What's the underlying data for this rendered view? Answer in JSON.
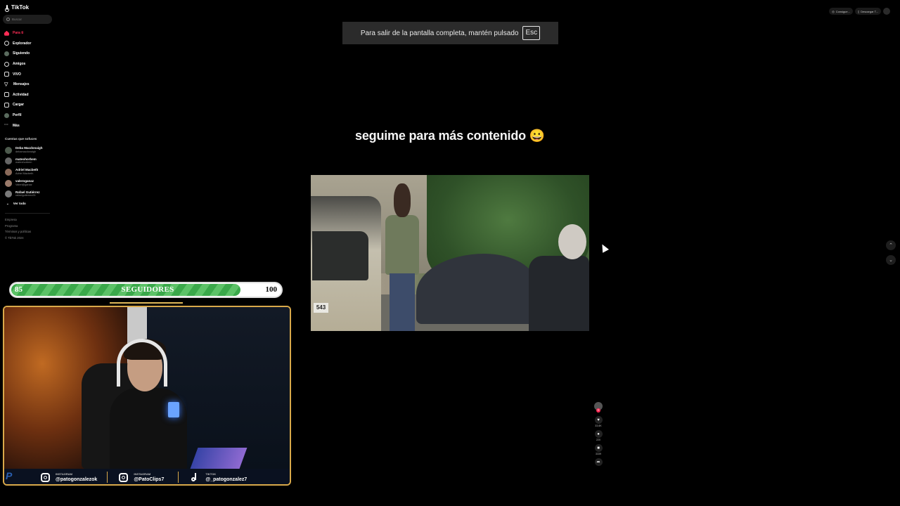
{
  "sidebar": {
    "logo": "TikTok",
    "search_placeholder": "Buscar",
    "nav": [
      {
        "label": "Para ti",
        "icon": "home-icon",
        "active": true
      },
      {
        "label": "Explorador",
        "icon": "compass-icon"
      },
      {
        "label": "Siguiendo",
        "icon": "following-icon"
      },
      {
        "label": "Amigos",
        "icon": "friends-icon"
      },
      {
        "label": "VIVO",
        "icon": "live-icon"
      },
      {
        "label": "Mensajes",
        "icon": "message-icon"
      },
      {
        "label": "Actividad",
        "icon": "activity-icon"
      },
      {
        "label": "Cargar",
        "icon": "upload-icon"
      },
      {
        "label": "Perfil",
        "icon": "profile-avatar"
      },
      {
        "label": "Más",
        "icon": "more-icon"
      }
    ],
    "following_title": "Cuentas que sofuces",
    "following": [
      {
        "name": "Deba Macdonaigh",
        "user": "debamacdonaigh"
      },
      {
        "name": "mateohorbem",
        "user": "mateohorbem"
      },
      {
        "name": "Adriel Macbeth",
        "user": "Adriel Macbeth"
      },
      {
        "name": "valeroganaz",
        "user": "Valeri@ganaz"
      },
      {
        "name": "Rafael Gutiérrez",
        "user": "rafaelgutierrez26"
      }
    ],
    "see_all": "Ver todo",
    "footer": [
      "Empresa",
      "Programa",
      "Términos y políticas",
      "© TikTok 2024"
    ]
  },
  "top_right": {
    "btn1": "Consigue...",
    "btn2": "Descargar T..."
  },
  "fullscreen_banner": {
    "text": "Para salir de la pantalla completa, mantén pulsado",
    "key": "Esc"
  },
  "video": {
    "caption": "seguime para más contenido 😀",
    "plate": "543"
  },
  "actions": {
    "likes": "33,6K",
    "comments": "220",
    "saves": "3339"
  },
  "overlay": {
    "goal_start": "85",
    "goal_label": "SEGUIDORES",
    "goal_end": "100",
    "goal_progress": 0.85,
    "social": [
      {
        "platform": "INSTAGRAM",
        "handle": "@patogonzalezok"
      },
      {
        "platform": "INSTAGRAM",
        "handle": "@PatoClips7"
      },
      {
        "platform": "TIKTOK",
        "handle": "@_patogonzalez7"
      }
    ]
  },
  "colors": {
    "accent": "#fe2c55",
    "goal_green": "#3aa84a",
    "frame_gold": "#d9a94a"
  }
}
